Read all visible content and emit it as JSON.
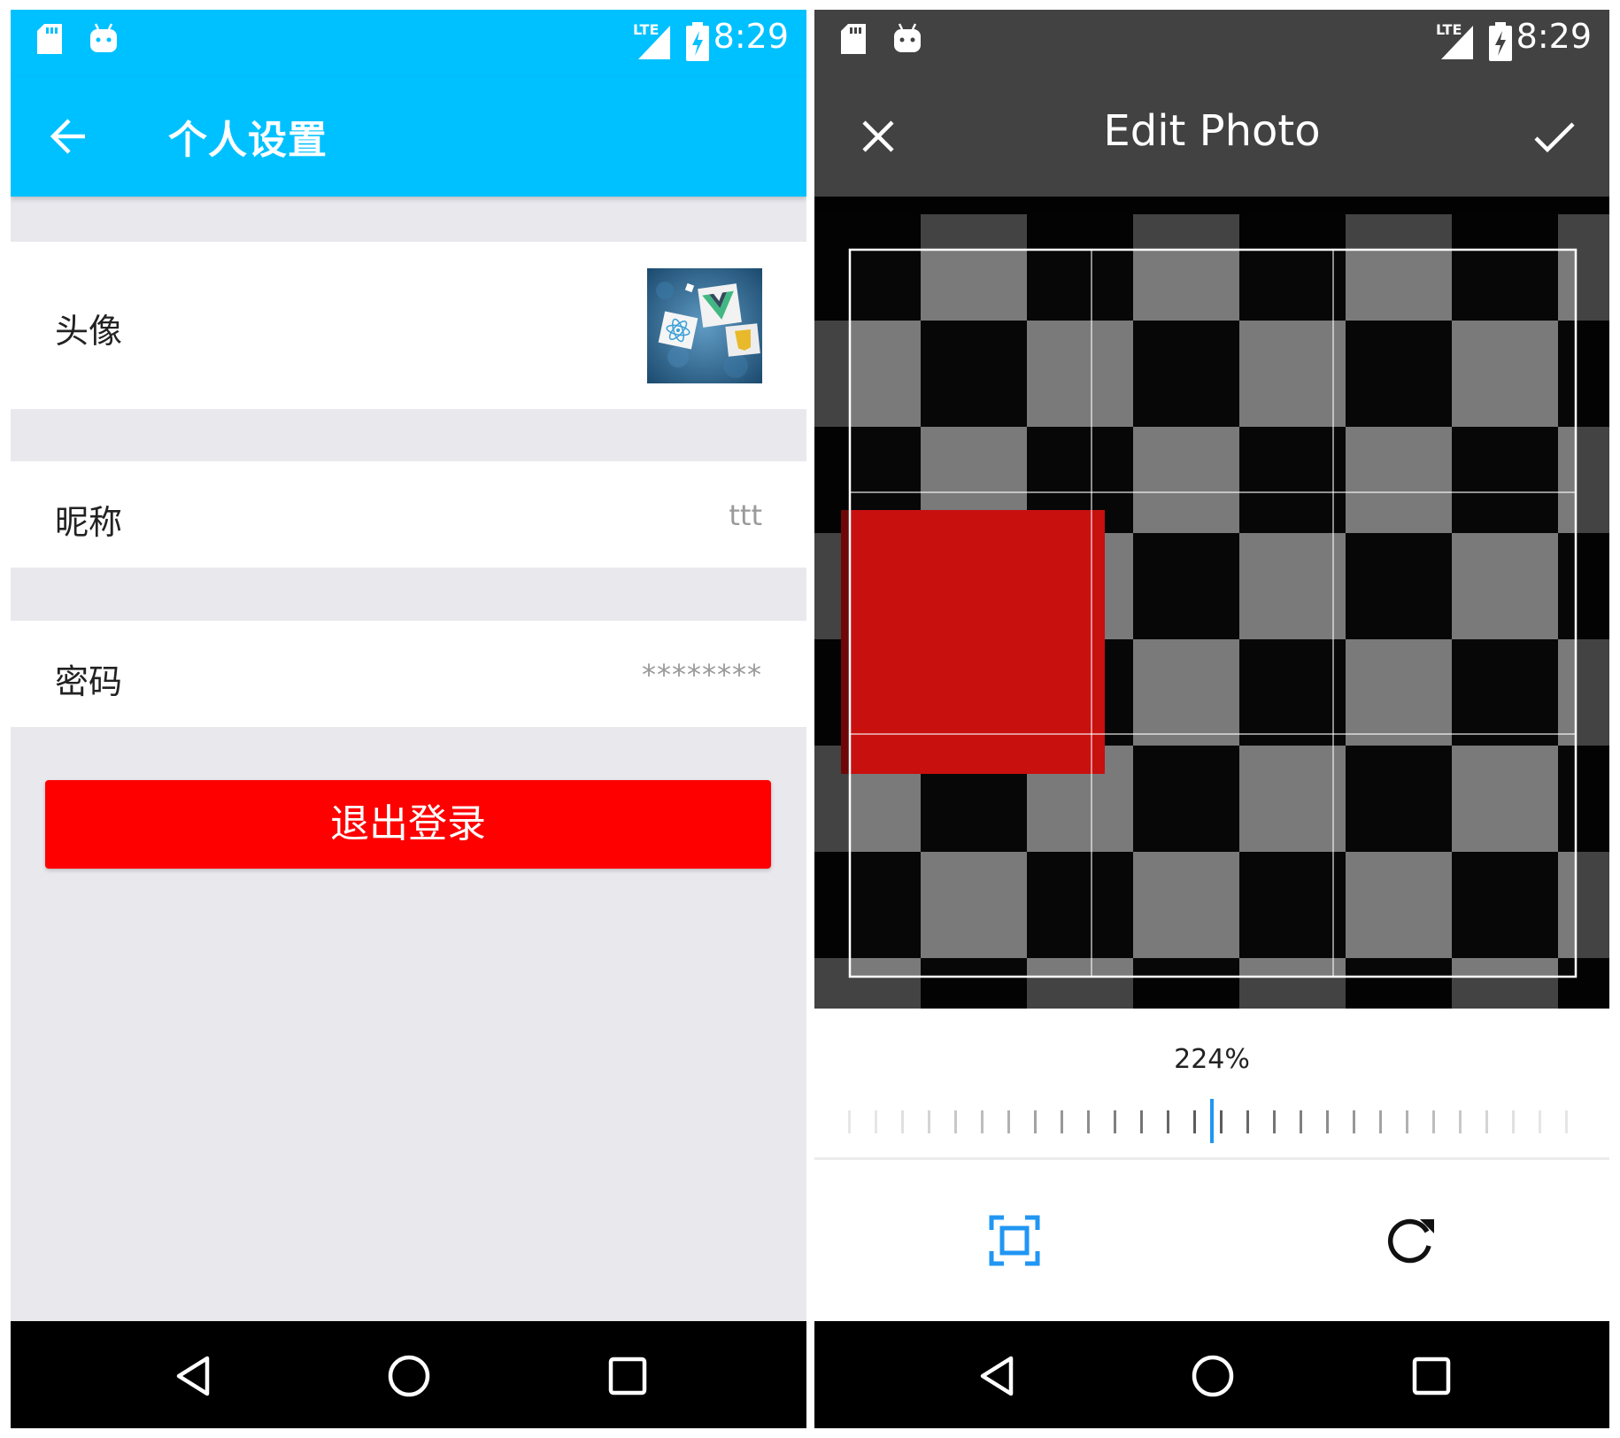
{
  "left_screen": {
    "status_bar": {
      "time": "8:29",
      "network": "LTE",
      "icons": [
        "sd-card-icon",
        "android-debug-icon",
        "signal-icon",
        "battery-charging-icon"
      ]
    },
    "app_bar": {
      "back_icon": "arrow-left-icon",
      "title": "个人设置"
    },
    "rows": {
      "avatar": {
        "label": "头像",
        "image": "avatar-thumbnail"
      },
      "nickname": {
        "label": "昵称",
        "value": "ttt"
      },
      "password": {
        "label": "密码",
        "value": "********"
      }
    },
    "logout_button": "退出登录",
    "nav_bar": [
      "back-triangle-icon",
      "home-circle-icon",
      "recents-square-icon"
    ]
  },
  "right_screen": {
    "status_bar": {
      "time": "8:29",
      "network": "LTE"
    },
    "app_bar": {
      "close_icon": "close-icon",
      "title": "Edit Photo",
      "confirm_icon": "check-icon"
    },
    "zoom_percent": "224%",
    "toolbar": [
      "aspect-ratio-icon",
      "rotate-icon"
    ],
    "nav_bar": [
      "back-triangle-icon",
      "home-circle-icon",
      "recents-square-icon"
    ]
  },
  "colors": {
    "left_primary": "#00c1ff",
    "right_primary": "#424242",
    "logout_red": "#ff0000",
    "accent_blue": "#2196f3",
    "background_gray": "#e9e8ed",
    "red_square": "#c8100f"
  }
}
